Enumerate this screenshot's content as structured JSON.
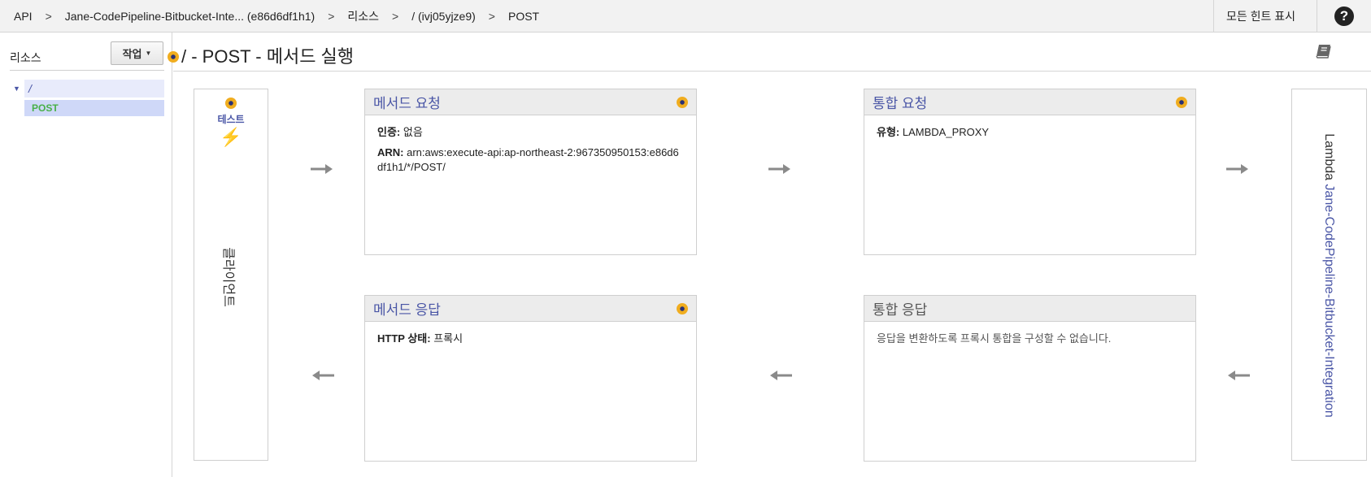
{
  "breadcrumb": {
    "items": [
      "API",
      "Jane-CodePipeline-Bitbucket-Inte... (e86d6df1h1)",
      "리소스",
      "/ (ivj05yjze9)",
      "POST"
    ],
    "separator": ">"
  },
  "header": {
    "hints_label": "모든 힌트 표시",
    "help_label": "?"
  },
  "sidebar": {
    "title": "리소스",
    "action_label": "작업",
    "tree": {
      "root_label": "/",
      "method_label": "POST"
    }
  },
  "main": {
    "title": "/ - POST - 메서드 실행"
  },
  "client": {
    "test_label": "테스트",
    "label": "클라이언트"
  },
  "method_request": {
    "title": "메서드 요청",
    "auth_key": "인증:",
    "auth_value": "없음",
    "arn_key": "ARN:",
    "arn_value": "arn:aws:execute-api:ap-northeast-2:967350950153:e86d6df1h1/*/POST/"
  },
  "integration_request": {
    "title": "통합 요청",
    "type_key": "유형:",
    "type_value": "LAMBDA_PROXY"
  },
  "method_response": {
    "title": "메서드 응답",
    "status_key": "HTTP 상태:",
    "status_value": "프록시"
  },
  "integration_response": {
    "title": "통합 응답",
    "note": "응답을 변환하도록 프록시 통합을 구성할 수 없습니다."
  },
  "lambda": {
    "prefix": "Lambda",
    "function_name": "Jane-CodePipeline-Bitbucket-Integration"
  },
  "colors": {
    "accent": "#4a56a6",
    "hint_dot": "#f0ad1f",
    "post_green": "#48b048",
    "arrow": "#8a8a8a"
  }
}
